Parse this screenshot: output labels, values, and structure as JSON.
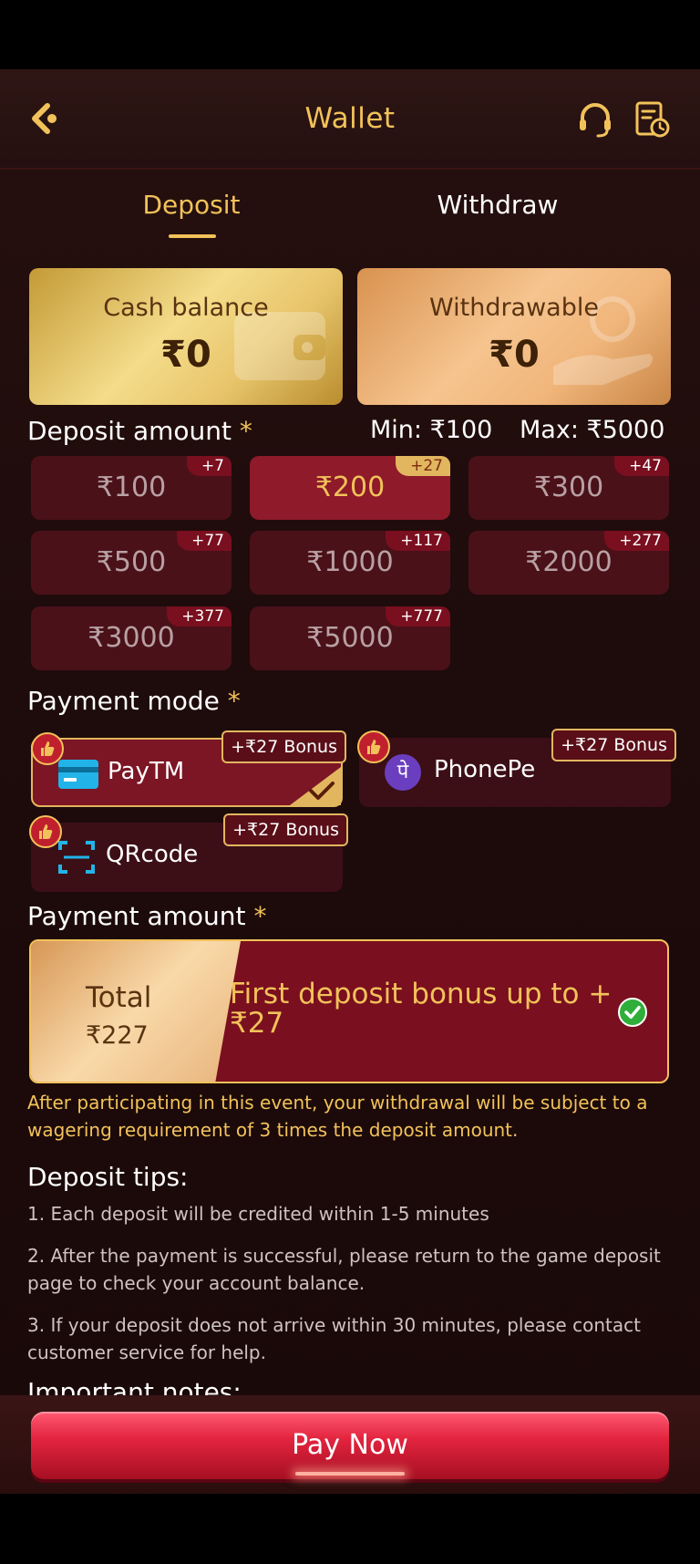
{
  "header": {
    "title": "Wallet"
  },
  "tabs": [
    {
      "label": "Deposit",
      "active": true
    },
    {
      "label": "Withdraw",
      "active": false
    }
  ],
  "balances": {
    "cash": {
      "label": "Cash balance",
      "value": "₹0"
    },
    "withdrawable": {
      "label": "Withdrawable",
      "value": "₹0"
    }
  },
  "deposit": {
    "title": "Deposit amount",
    "required_mark": "*",
    "min": "Min: ₹100",
    "max": "Max: ₹5000",
    "amounts": [
      {
        "label": "₹100",
        "bonus": "+7",
        "selected": false
      },
      {
        "label": "₹200",
        "bonus": "+27",
        "selected": true
      },
      {
        "label": "₹300",
        "bonus": "+47",
        "selected": false
      },
      {
        "label": "₹500",
        "bonus": "+77",
        "selected": false
      },
      {
        "label": "₹1000",
        "bonus": "+117",
        "selected": false
      },
      {
        "label": "₹2000",
        "bonus": "+277",
        "selected": false
      },
      {
        "label": "₹3000",
        "bonus": "+377",
        "selected": false
      },
      {
        "label": "₹5000",
        "bonus": "+777",
        "selected": false
      }
    ]
  },
  "payment_mode": {
    "title": "Payment mode",
    "required_mark": "*",
    "methods": [
      {
        "label": "PayTM",
        "bonus": "+₹27 Bonus",
        "selected": true,
        "icon": "card-icon"
      },
      {
        "label": "PhonePe",
        "bonus": "+₹27 Bonus",
        "selected": false,
        "icon": "phonepe-icon",
        "icon_glyph": "पे"
      },
      {
        "label": "QRcode",
        "bonus": "+₹27 Bonus",
        "selected": false,
        "icon": "scan-icon"
      }
    ]
  },
  "payment_amount": {
    "title": "Payment amount",
    "required_mark": "*",
    "total_label": "Total",
    "total_value": "₹227",
    "bonus_text": "First deposit bonus up to +₹27"
  },
  "warning": "After participating in this event, your withdrawal will be subject to a wagering requirement of 3 times the deposit amount.",
  "tips": {
    "title": "Deposit tips:",
    "items": [
      "1. Each deposit will be credited within 1-5 minutes",
      "2. After the payment is successful, please return to the game deposit page to check your account balance.",
      "3. If your deposit does not arrive within 30 minutes, please contact customer service for help."
    ]
  },
  "notes": {
    "title": "Important notes:"
  },
  "footer": {
    "pay_label": "Pay Now"
  },
  "colors": {
    "gold": "#f2c25a",
    "maroon": "#7a0f1f",
    "button_red": "#e3243f"
  }
}
